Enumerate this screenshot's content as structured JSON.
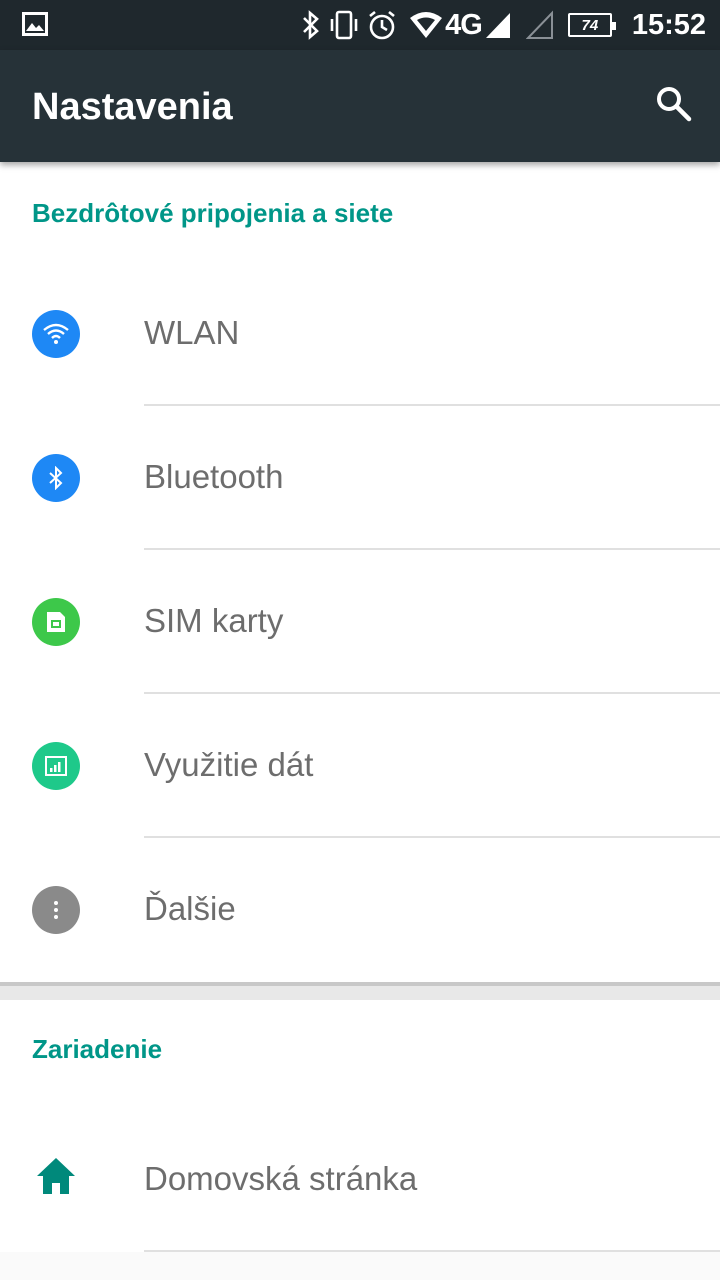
{
  "status_bar": {
    "icons_left": [
      "image-notification-icon"
    ],
    "icons_right": [
      "bluetooth-icon",
      "vibrate-icon",
      "alarm-icon",
      "wifi-signal-icon",
      "cell-signal-icon",
      "cell-signal-empty-icon"
    ],
    "network_type": "4G",
    "battery_level": "74",
    "time": "15:52"
  },
  "app_bar": {
    "title": "Nastavenia",
    "search_icon": "search-icon"
  },
  "sections": [
    {
      "title": "Bezdrôtové pripojenia a siete",
      "items": [
        {
          "label": "WLAN",
          "icon": "wifi-icon",
          "icon_color": "#1e88f5"
        },
        {
          "label": "Bluetooth",
          "icon": "bluetooth-icon",
          "icon_color": "#1e88f5"
        },
        {
          "label": "SIM karty",
          "icon": "sim-card-icon",
          "icon_color": "#3dc84a"
        },
        {
          "label": "Využitie dát",
          "icon": "data-usage-icon",
          "icon_color": "#1ec98a"
        },
        {
          "label": "Ďalšie",
          "icon": "more-icon",
          "icon_color": "#8a8a8a"
        }
      ]
    },
    {
      "title": "Zariadenie",
      "items": [
        {
          "label": "Domovská stránka",
          "icon": "home-icon",
          "icon_color": "#00897b"
        }
      ]
    }
  ],
  "colors": {
    "accent": "#009688",
    "app_bar": "#263238",
    "status_bar": "#1f282d"
  }
}
